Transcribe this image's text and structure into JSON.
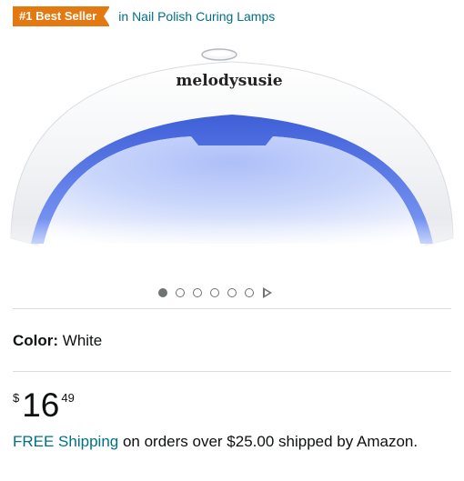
{
  "badge": {
    "label": "#1 Best Seller",
    "category": "in Nail Polish Curing Lamps",
    "color": "#e47911"
  },
  "product_image": {
    "brand_text": "melodysusie",
    "glow_color": "#5d7ff0"
  },
  "carousel": {
    "slide_count": 6,
    "active_index": 0,
    "video_icon": "play-icon"
  },
  "color_selector": {
    "label": "Color:",
    "value": "White"
  },
  "price": {
    "symbol": "$",
    "whole": "16",
    "fraction": "49"
  },
  "shipping": {
    "link": "FREE Shipping",
    "text": " on orders over $25.00 shipped by Amazon."
  },
  "colors": {
    "link": "#007185",
    "text": "#0f1111",
    "divider": "#dddddd"
  }
}
